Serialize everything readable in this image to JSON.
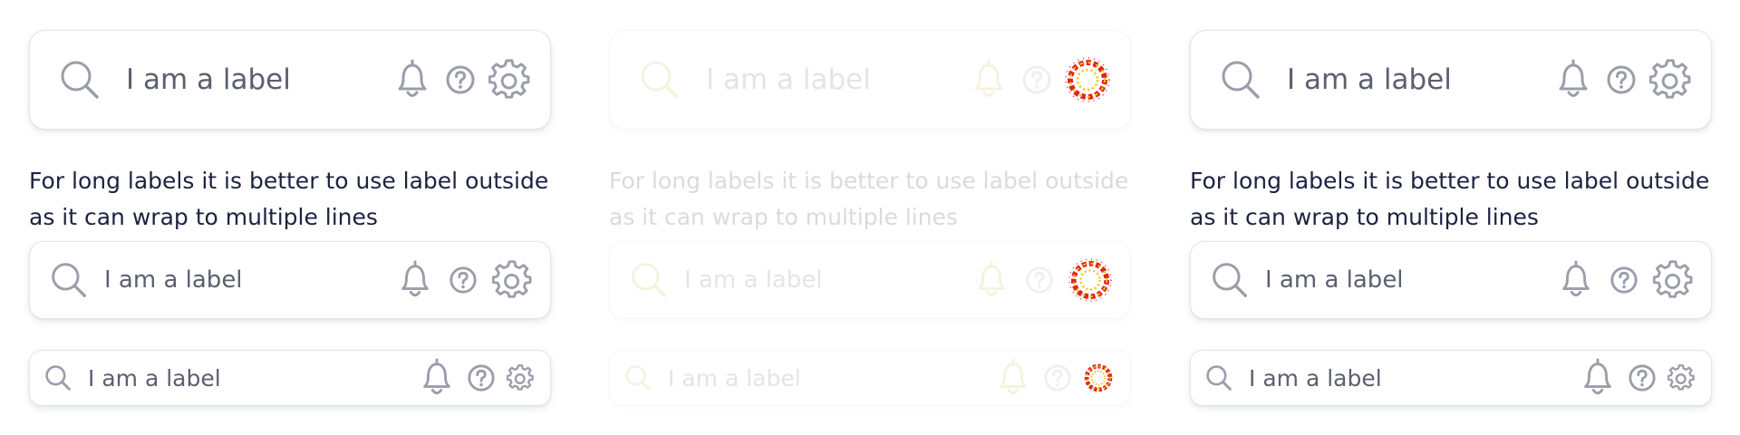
{
  "fields": {
    "label": "I am a label"
  },
  "note": {
    "text": "For long labels it is better to use label outside as it can wrap to multiple lines"
  },
  "icons": {
    "leading": "search-icon",
    "trailing": [
      "bell-icon",
      "help-icon",
      "gear-icon"
    ]
  },
  "colors": {
    "label_text": "#5b6070",
    "icon_stroke": "#9a9ea9",
    "border": "#e3e5ea",
    "note_text": "#1c2340",
    "broken_icon_red": "#e0261c",
    "broken_icon_yellow": "#f2c400"
  },
  "panels": [
    {
      "state": "default"
    },
    {
      "state": "disabled"
    },
    {
      "state": "default"
    }
  ]
}
